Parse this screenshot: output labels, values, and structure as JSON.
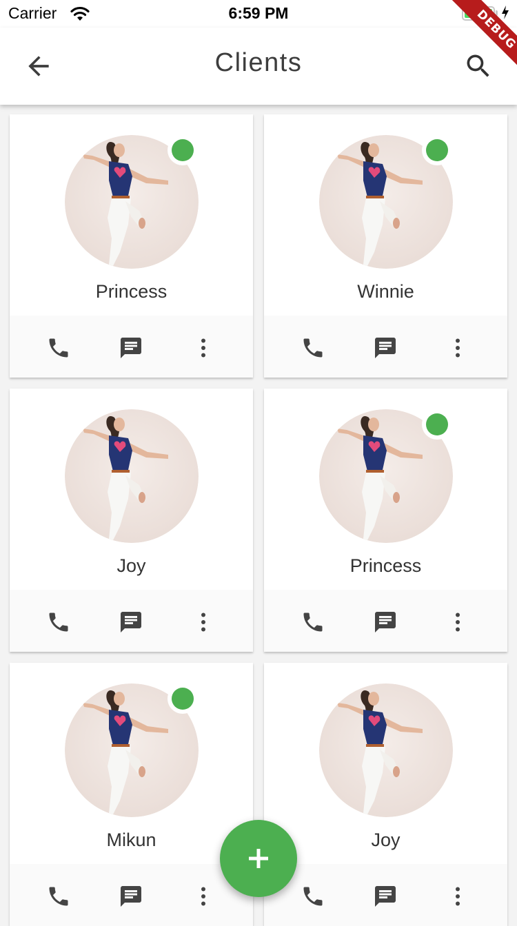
{
  "status_bar": {
    "carrier": "Carrier",
    "time": "6:59 PM",
    "debug_banner": "DEBUG"
  },
  "app_bar": {
    "title": "Clients",
    "back_icon": "arrow-back-icon",
    "search_icon": "search-icon"
  },
  "colors": {
    "accent": "#4caf50",
    "debug": "#b71c1c",
    "battery": "#4cd964"
  },
  "clients": [
    {
      "name": "Princess",
      "online": true
    },
    {
      "name": "Winnie",
      "online": true
    },
    {
      "name": "Joy",
      "online": false
    },
    {
      "name": "Princess",
      "online": true
    },
    {
      "name": "Mikun",
      "online": true
    },
    {
      "name": "Joy",
      "online": false
    }
  ],
  "card_actions": [
    "phone-icon",
    "message-icon",
    "more-vert-icon"
  ],
  "fab": {
    "icon": "add-icon"
  }
}
